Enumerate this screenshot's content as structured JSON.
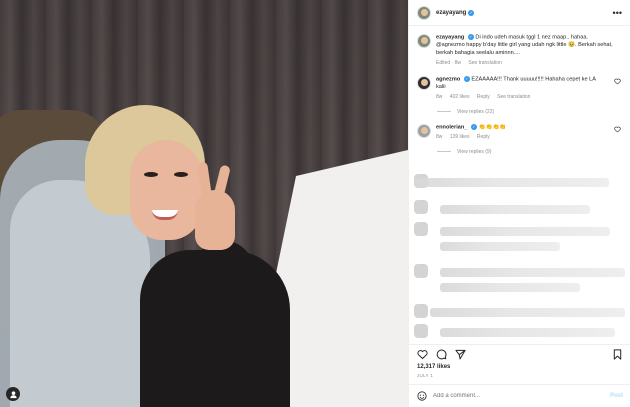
{
  "post": {
    "username": "ezayayang",
    "more_icon": "more-horizontal-icon",
    "caption_text": "Di indo udeh masuk tggl 1 nez maap.. hahaa. @agnezmo happy b'day little girl yang udah ngk little 🥹. Berkah sehat, berkah bahagia seelalu aminnn....",
    "caption_meta": {
      "edited": "Edited · 8w",
      "translation": "See translation"
    },
    "likes": "12,317 likes",
    "date": "JULY 1"
  },
  "comments": [
    {
      "username": "agnezmo",
      "text": "EZAAAAA!!! Thank uuuuu!!!!! Hahaha cepet ke LA kalii",
      "time": "8w",
      "likes": "402 likes",
      "reply": "Reply",
      "translation": "See translation",
      "view_replies": "View replies (22)"
    },
    {
      "username": "ennolerian_",
      "text": "👏👏👏👏",
      "time": "8w",
      "likes": "139 likes",
      "reply": "Reply",
      "view_replies": "View replies (9)"
    }
  ],
  "add_comment": {
    "placeholder": "Add a comment...",
    "post_label": "Post"
  },
  "colors": {
    "verified": "#3797f0",
    "muted": "#8e8e8e",
    "text": "#262626"
  }
}
